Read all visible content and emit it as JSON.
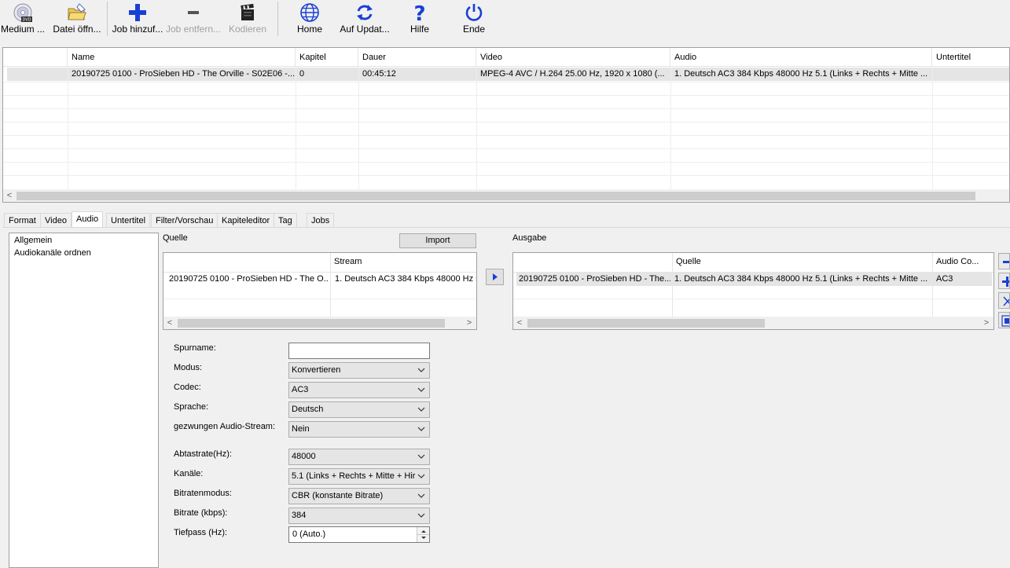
{
  "toolbar": {
    "medium": "Medium ...",
    "open_file": "Datei öffn...",
    "add_job": "Job hinzuf...",
    "remove_job": "Job entfern...",
    "encode": "Kodieren",
    "home": "Home",
    "update": "Auf Updat...",
    "help": "Hilfe",
    "exit": "Ende"
  },
  "jobs": {
    "columns": [
      "Name",
      "Kapitel",
      "Dauer",
      "Video",
      "Audio",
      "Untertitel"
    ],
    "row": {
      "name": "20190725 0100 - ProSieben HD - The Orville - S02E06 -...",
      "chapters": "0",
      "duration": "00:45:12",
      "video": "MPEG-4 AVC / H.264 25.00 Hz, 1920 x 1080 (...",
      "audio": "1. Deutsch AC3 384 Kbps 48000 Hz 5.1 (Links + Rechts + Mitte ...",
      "subtitle": ""
    }
  },
  "tabs": [
    "Format",
    "Video",
    "Audio",
    "Untertitel",
    "Filter/Vorschau",
    "Kapiteleditor",
    "Tag",
    "Jobs"
  ],
  "sidebar": {
    "items": [
      "Allgemein",
      "Audiokanäle ordnen"
    ]
  },
  "source": {
    "label": "Quelle",
    "import_button": "Import",
    "stream_header": "Stream",
    "row_file": "20190725 0100 - ProSieben HD - The O...",
    "row_stream": "1. Deutsch AC3 384 Kbps 48000 Hz 5"
  },
  "output": {
    "label": "Ausgabe",
    "source_header": "Quelle",
    "codec_header": "Audio Co...",
    "row_file": "20190725 0100 - ProSieben HD - The...",
    "row_source": "1. Deutsch AC3 384 Kbps 48000 Hz 5.1 (Links + Rechts + Mitte ...",
    "row_codec": "AC3"
  },
  "form": {
    "track_name_label": "Spurname:",
    "track_name_value": "",
    "mode_label": "Modus:",
    "mode_value": "Konvertieren",
    "codec_label": "Codec:",
    "codec_value": "AC3",
    "language_label": "Sprache:",
    "language_value": "Deutsch",
    "forced_label": "gezwungen Audio-Stream:",
    "forced_value": "Nein",
    "samplerate_label": "Abtastrate(Hz):",
    "samplerate_value": "48000",
    "channels_label": "Kanäle:",
    "channels_value": "5.1 (Links + Rechts + Mitte + Hir",
    "bitrate_mode_label": "Bitratenmodus:",
    "bitrate_mode_value": "CBR (konstante Bitrate)",
    "bitrate_label": "Bitrate (kbps):",
    "bitrate_value": "384",
    "lowpass_label": "Tiefpass (Hz):",
    "lowpass_value": "0 (Auto.)"
  },
  "colors": {
    "accent_blue": "#1a3fd6",
    "window_bg": "#f0f0f0",
    "disabled_text": "#a0a0a0"
  }
}
